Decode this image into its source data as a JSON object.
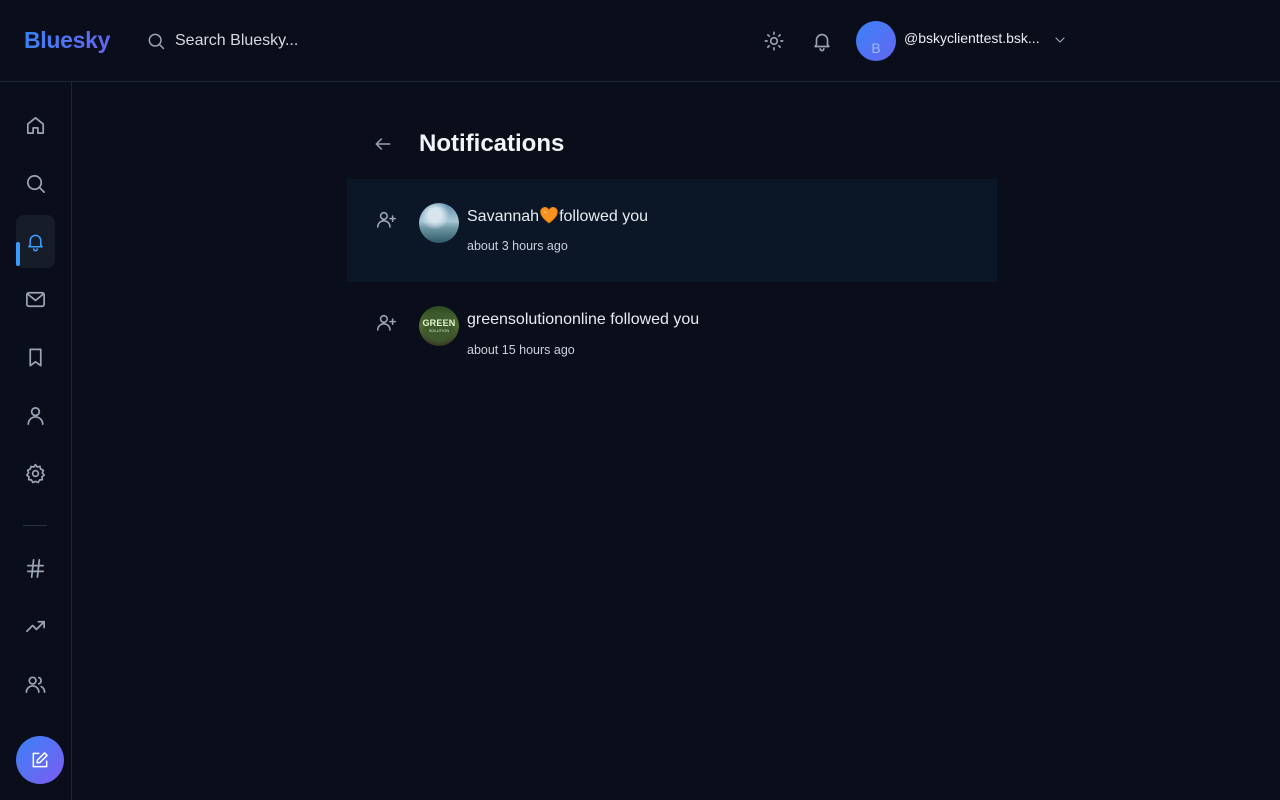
{
  "app": {
    "logo": "Bluesky",
    "brand_colors": [
      "#3b82f6",
      "#6366f1"
    ]
  },
  "search": {
    "placeholder": "Search Bluesky...",
    "icon": "search-icon"
  },
  "topbar": {
    "theme_icon": "sun-icon",
    "notifications_icon": "bell-icon",
    "account": {
      "handle": "@bskyclienttest.bsk...",
      "avatar_letter": "B",
      "menu_icon": "chevron-down-icon"
    }
  },
  "sidebar": {
    "items": [
      {
        "name": "home",
        "icon": "home-icon"
      },
      {
        "name": "search",
        "icon": "search-icon"
      },
      {
        "name": "notifications",
        "icon": "bell-icon",
        "active": true
      },
      {
        "name": "messages",
        "icon": "mail-icon"
      },
      {
        "name": "bookmarks",
        "icon": "bookmark-icon"
      },
      {
        "name": "profile",
        "icon": "user-icon"
      },
      {
        "name": "settings",
        "icon": "gear-icon"
      },
      {
        "name": "feeds",
        "icon": "hash-icon"
      },
      {
        "name": "trending",
        "icon": "trending-icon"
      },
      {
        "name": "lists",
        "icon": "users-icon"
      }
    ],
    "compose_icon": "compose-icon",
    "accent_color": "#3b9cff"
  },
  "page": {
    "title": "Notifications",
    "back_icon": "arrow-left-icon"
  },
  "notifications": [
    {
      "type": "follow",
      "name": "Savannah",
      "emoji": "🧡",
      "action": "followed you",
      "time": "about 3 hours ago",
      "unread": true
    },
    {
      "type": "follow",
      "name": "greensolutiononline",
      "action": "followed you",
      "time": "about 15 hours ago",
      "unread": false,
      "avatar_text": "GREEN",
      "avatar_subtext": "SOLUTION"
    }
  ]
}
